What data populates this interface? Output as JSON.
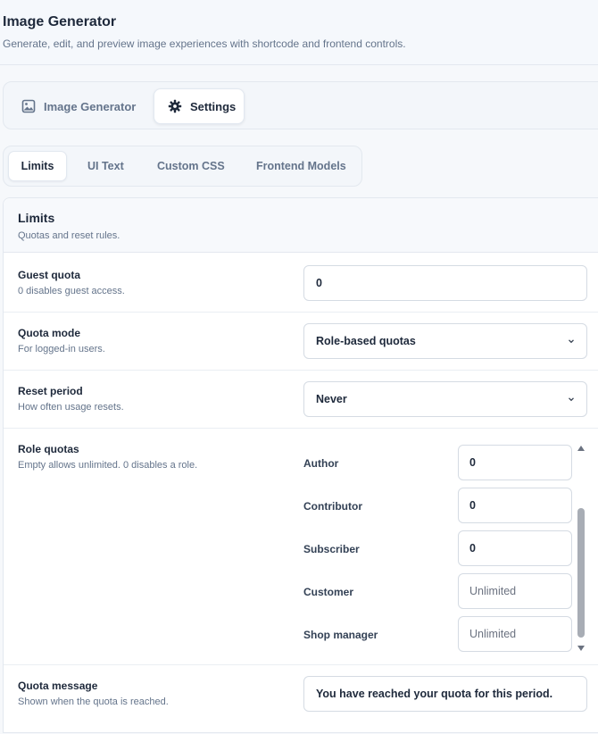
{
  "header": {
    "title": "Image Generator",
    "subtitle": "Generate, edit, and preview image experiences with shortcode and frontend controls."
  },
  "main_tabs": [
    {
      "label": "Image Generator",
      "icon": "image-icon",
      "active": false
    },
    {
      "label": "Settings",
      "icon": "gear-icon",
      "active": true
    }
  ],
  "sub_tabs": [
    {
      "label": "Limits",
      "active": true
    },
    {
      "label": "UI Text",
      "active": false
    },
    {
      "label": "Custom CSS",
      "active": false
    },
    {
      "label": "Frontend Models",
      "active": false
    }
  ],
  "panel": {
    "title": "Limits",
    "subtitle": "Quotas and reset rules."
  },
  "fields": {
    "guest_quota": {
      "label": "Guest quota",
      "help": "0 disables guest access.",
      "value": "0"
    },
    "quota_mode": {
      "label": "Quota mode",
      "help": "For logged-in users.",
      "value": "Role-based quotas"
    },
    "reset_period": {
      "label": "Reset period",
      "help": "How often usage resets.",
      "value": "Never"
    },
    "role_quotas": {
      "label": "Role quotas",
      "help": "Empty allows unlimited. 0 disables a role.",
      "roles": [
        {
          "name": "Author",
          "value": "0",
          "placeholder": ""
        },
        {
          "name": "Contributor",
          "value": "0",
          "placeholder": ""
        },
        {
          "name": "Subscriber",
          "value": "0",
          "placeholder": ""
        },
        {
          "name": "Customer",
          "value": "",
          "placeholder": "Unlimited"
        },
        {
          "name": "Shop manager",
          "value": "",
          "placeholder": "Unlimited"
        }
      ]
    },
    "quota_message": {
      "label": "Quota message",
      "help": "Shown when the quota is reached.",
      "value": "You have reached your quota for this period."
    }
  },
  "colors": {
    "text": "#1e293b",
    "muted": "#64748b",
    "border": "#d5dbe3",
    "panel_bg": "#f7f9fc"
  }
}
